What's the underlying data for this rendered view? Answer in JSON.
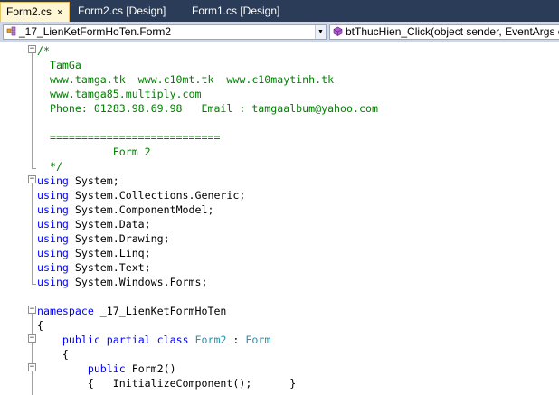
{
  "tabs": [
    {
      "label": "Form2.cs",
      "close": "×",
      "active": true
    },
    {
      "label": "Form2.cs [Design]",
      "active": false
    },
    {
      "label": "Form1.cs [Design]",
      "active": false
    }
  ],
  "nav": {
    "class_combo": "_17_LienKetFormHoTen.Form2",
    "member_combo": "btThucHien_Click(object sender, EventArgs e)"
  },
  "code_lines": [
    {
      "segments": [
        {
          "t": "/*",
          "c": "c"
        }
      ]
    },
    {
      "segments": [
        {
          "t": "  TamGa",
          "c": "c"
        }
      ]
    },
    {
      "segments": [
        {
          "t": "  www.tamga.tk  www.c10mt.tk  www.c10maytinh.tk",
          "c": "c"
        }
      ]
    },
    {
      "segments": [
        {
          "t": "  www.tamga85.multiply.com",
          "c": "c"
        }
      ]
    },
    {
      "segments": [
        {
          "t": "  Phone: 01283.98.69.98   Email : tamgaalbum@yahoo.com",
          "c": "c"
        }
      ]
    },
    {
      "segments": [
        {
          "t": "",
          "c": "c"
        }
      ]
    },
    {
      "segments": [
        {
          "t": "  ===========================",
          "c": "c"
        }
      ]
    },
    {
      "segments": [
        {
          "t": "            Form 2",
          "c": "c"
        }
      ]
    },
    {
      "segments": [
        {
          "t": "  */",
          "c": "c"
        }
      ]
    },
    {
      "segments": [
        {
          "t": "using",
          "c": "k"
        },
        {
          "t": " System;",
          "c": "n"
        }
      ]
    },
    {
      "segments": [
        {
          "t": "using",
          "c": "k"
        },
        {
          "t": " System.Collections.Generic;",
          "c": "n"
        }
      ]
    },
    {
      "segments": [
        {
          "t": "using",
          "c": "k"
        },
        {
          "t": " System.ComponentModel;",
          "c": "n"
        }
      ]
    },
    {
      "segments": [
        {
          "t": "using",
          "c": "k"
        },
        {
          "t": " System.Data;",
          "c": "n"
        }
      ]
    },
    {
      "segments": [
        {
          "t": "using",
          "c": "k"
        },
        {
          "t": " System.Drawing;",
          "c": "n"
        }
      ]
    },
    {
      "segments": [
        {
          "t": "using",
          "c": "k"
        },
        {
          "t": " System.Linq;",
          "c": "n"
        }
      ]
    },
    {
      "segments": [
        {
          "t": "using",
          "c": "k"
        },
        {
          "t": " System.Text;",
          "c": "n"
        }
      ]
    },
    {
      "segments": [
        {
          "t": "using",
          "c": "k"
        },
        {
          "t": " System.Windows.Forms;",
          "c": "n"
        }
      ]
    },
    {
      "segments": [
        {
          "t": "",
          "c": "n"
        }
      ]
    },
    {
      "segments": [
        {
          "t": "namespace",
          "c": "k"
        },
        {
          "t": " _17_LienKetFormHoTen",
          "c": "n"
        }
      ]
    },
    {
      "segments": [
        {
          "t": "{",
          "c": "n"
        }
      ]
    },
    {
      "segments": [
        {
          "t": "    ",
          "c": "n"
        },
        {
          "t": "public",
          "c": "k"
        },
        {
          "t": " ",
          "c": "n"
        },
        {
          "t": "partial",
          "c": "k"
        },
        {
          "t": " ",
          "c": "n"
        },
        {
          "t": "class",
          "c": "k"
        },
        {
          "t": " ",
          "c": "n"
        },
        {
          "t": "Form2",
          "c": "t"
        },
        {
          "t": " : ",
          "c": "n"
        },
        {
          "t": "Form",
          "c": "t"
        }
      ]
    },
    {
      "segments": [
        {
          "t": "    {",
          "c": "n"
        }
      ]
    },
    {
      "segments": [
        {
          "t": "        ",
          "c": "n"
        },
        {
          "t": "public",
          "c": "k"
        },
        {
          "t": " Form2()",
          "c": "n"
        }
      ]
    },
    {
      "segments": [
        {
          "t": "        {   InitializeComponent();      }",
          "c": "n"
        }
      ]
    }
  ]
}
